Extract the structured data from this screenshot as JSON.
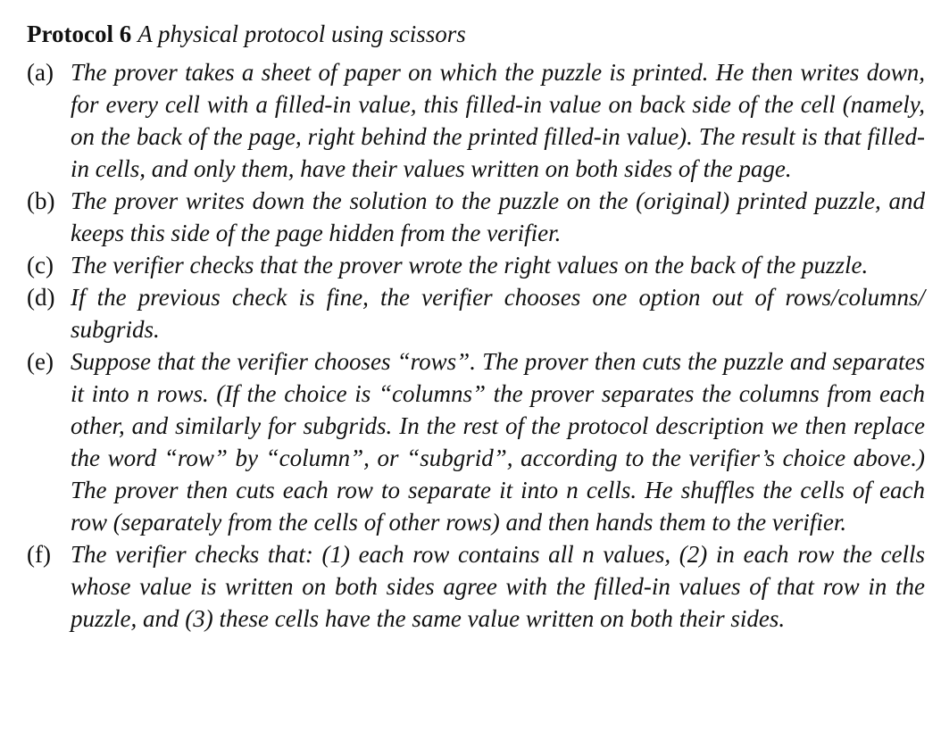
{
  "protocol": {
    "label": "Protocol 6",
    "title": "A physical protocol using scissors"
  },
  "steps": [
    {
      "marker": "(a)",
      "text": "The prover takes a sheet of paper on which the puzzle is printed. He then writes down, for every cell with a filled-in value, this filled-in value on back side of the cell (namely, on the back of the page, right behind the printed filled-in value). The result is that filled-in cells, and only them, have their values written on both sides of the page."
    },
    {
      "marker": "(b)",
      "text": "The prover writes down the solution to the puzzle on the (original) printed puzzle, and keeps this side of the page hidden from the verifier."
    },
    {
      "marker": "(c)",
      "text": "The verifier checks that the prover wrote the right values on the back of the puzzle."
    },
    {
      "marker": "(d)",
      "text": "If the previous check is fine, the verifier chooses one option out of rows/columns/ subgrids."
    },
    {
      "marker": "(e)",
      "text": "Suppose that the verifier chooses “rows”. The prover then cuts the puzzle and separates it into n rows. (If the choice is “columns” the prover separates the columns from each other, and similarly for subgrids. In the rest of the protocol description we then replace the word “row” by “column”, or “subgrid”, according to the verifier’s choice above.) The prover then cuts each row to separate it into n cells. He shuffles the cells of each row (separately from the cells of other rows) and then hands them to the verifier."
    },
    {
      "marker": "(f)",
      "text": "The verifier checks that: (1) each row contains all n values, (2) in each row the cells whose value is written on both sides agree with the filled-in values of that row in the puzzle, and (3) these cells have the same value written on both their sides."
    }
  ]
}
